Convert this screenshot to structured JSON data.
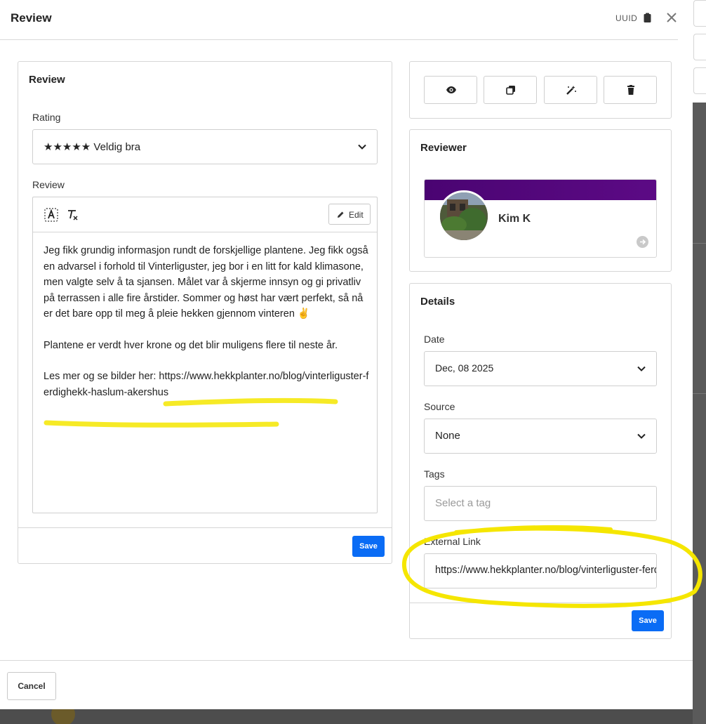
{
  "modal": {
    "title": "Review",
    "uuid_label": "UUID",
    "cancel_label": "Cancel"
  },
  "review_card": {
    "title": "Review",
    "rating_label": "Rating",
    "rating_value": "★★★★★ Veldig bra",
    "review_label": "Review",
    "edit_label": "Edit",
    "paragraphs": [
      "Jeg fikk grundig informasjon rundt de forskjellige plantene. Jeg fikk også en advarsel i forhold til Vinterliguster, jeg bor i en litt for kald klimasone, men valgte selv å ta sjansen. Målet var å skjerme innsyn og gi privatliv på terrassen i alle fire årstider. Sommer og høst har vært perfekt, så nå er det bare opp til meg å pleie hekken gjennom vinteren ✌",
      "Plantene er verdt hver krone og det blir muligens flere til neste år.",
      "Les mer og se bilder her: https://www.hekkplanter.no/blog/vinterliguster-ferdighekk-haslum-akershus"
    ],
    "save_label": "Save"
  },
  "actions": {
    "icons": [
      "eye-icon",
      "copy-icon",
      "magic-wand-icon",
      "trash-icon"
    ]
  },
  "reviewer_card": {
    "title": "Reviewer",
    "name": "Kim K",
    "banner_color": "#4a0472"
  },
  "details_card": {
    "title": "Details",
    "date_label": "Date",
    "date_value": "Dec, 08 2025",
    "source_label": "Source",
    "source_value": "None",
    "tags_label": "Tags",
    "tags_placeholder": "Select a tag",
    "external_link_label": "External Link",
    "external_link_value": "https://www.hekkplanter.no/blog/vinterliguster-ferdighekk-haslum-akershus",
    "save_label": "Save"
  },
  "colors": {
    "primary": "#0a6cf5",
    "highlight": "#f5e600"
  }
}
